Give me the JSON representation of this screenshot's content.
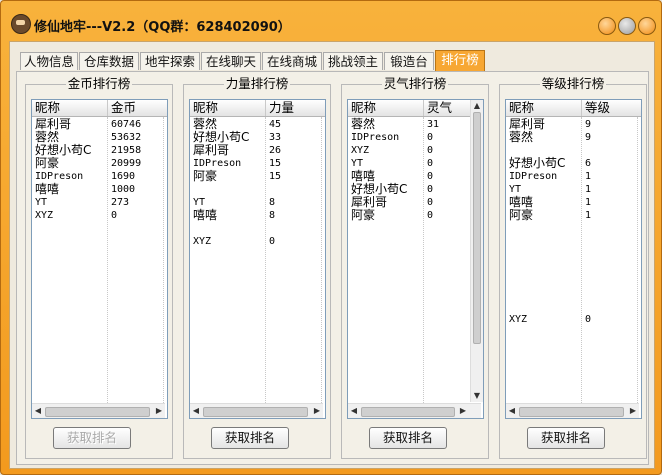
{
  "window": {
    "title": "修仙地牢---V2.2（QQ群：628402090）"
  },
  "tabs": [
    {
      "label": "人物信息"
    },
    {
      "label": "仓库数据"
    },
    {
      "label": "地牢探索"
    },
    {
      "label": "在线聊天"
    },
    {
      "label": "在线商城"
    },
    {
      "label": "挑战领主"
    },
    {
      "label": "锻造台"
    },
    {
      "label": "排行榜",
      "active": true
    }
  ],
  "panels": [
    {
      "title": "金币排行榜",
      "headers": [
        "昵称",
        "金币"
      ],
      "rows": [
        [
          "犀利哥",
          "60746"
        ],
        [
          "蓉然",
          "53632"
        ],
        [
          "好想小苟C",
          "21958"
        ],
        [
          "阿豪",
          "20999"
        ],
        [
          "IDPreson",
          "1690"
        ],
        [
          "嘻嘻",
          "1000"
        ],
        [
          "YT",
          "273"
        ],
        [
          "XYZ",
          "0"
        ]
      ],
      "button": "获取排名",
      "button_disabled": true
    },
    {
      "title": "力量排行榜",
      "headers": [
        "昵称",
        "力量"
      ],
      "rows": [
        [
          "蓉然",
          "45"
        ],
        [
          "好想小苟C",
          "33"
        ],
        [
          "犀利哥",
          "26"
        ],
        [
          "IDPreson",
          "15"
        ],
        [
          "阿豪",
          "15"
        ],
        [
          "",
          ""
        ],
        [
          "YT",
          "8"
        ],
        [
          "嘻嘻",
          "8"
        ],
        [
          "",
          ""
        ],
        [
          "XYZ",
          "0"
        ]
      ],
      "button": "获取排名",
      "button_disabled": false
    },
    {
      "title": "灵气排行榜",
      "headers": [
        "昵称",
        "灵气"
      ],
      "rows": [
        [
          "蓉然",
          "31"
        ],
        [
          "IDPreson",
          "0"
        ],
        [
          "XYZ",
          "0"
        ],
        [
          "YT",
          "0"
        ],
        [
          "嘻嘻",
          "0"
        ],
        [
          "好想小苟C",
          "0"
        ],
        [
          "犀利哥",
          "0"
        ],
        [
          "阿豪",
          "0"
        ]
      ],
      "button": "获取排名",
      "button_disabled": false
    },
    {
      "title": "等级排行榜",
      "headers": [
        "昵称",
        "等级"
      ],
      "rows": [
        [
          "犀利哥",
          "9"
        ],
        [
          "蓉然",
          "9"
        ],
        [
          "",
          ""
        ],
        [
          "好想小苟C",
          "6"
        ],
        [
          "IDPreson",
          "1"
        ],
        [
          "YT",
          "1"
        ],
        [
          "嘻嘻",
          "1"
        ],
        [
          "阿豪",
          "1"
        ],
        [
          "",
          ""
        ],
        [
          "",
          ""
        ],
        [
          "",
          ""
        ],
        [
          "",
          ""
        ],
        [
          "",
          ""
        ],
        [
          "",
          ""
        ],
        [
          "",
          ""
        ],
        [
          "XYZ",
          "0"
        ]
      ],
      "button": "获取排名",
      "button_disabled": false
    }
  ],
  "colors": {
    "accent": "#f7a733",
    "frame": "#f39a1e"
  }
}
